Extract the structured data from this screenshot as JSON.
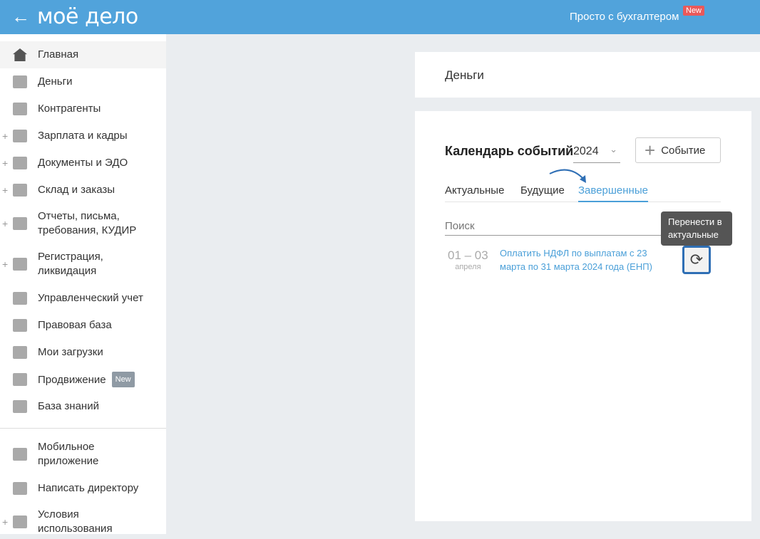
{
  "header": {
    "back": "←",
    "logo": "моё дело",
    "promo": "Просто с бухгалтером",
    "promo_badge": "New"
  },
  "sidebar": {
    "items": [
      {
        "label": "Главная",
        "icon": "home-icon"
      },
      {
        "label": "Деньги",
        "icon": "money-icon"
      },
      {
        "label": "Контрагенты",
        "icon": "contractor-icon"
      },
      {
        "label": "Зарплата и кадры",
        "icon": "wallet-icon",
        "expandable": "+"
      },
      {
        "label": "Документы и ЭДО",
        "icon": "folder-icon",
        "expandable": "+"
      },
      {
        "label": "Склад и заказы",
        "icon": "cart-icon",
        "expandable": "+"
      },
      {
        "label": "Отчеты, письма, требования, КУДИР",
        "icon": "report-icon",
        "expandable": "+"
      },
      {
        "label": "Регистрация, ликвидация",
        "icon": "registration-icon",
        "expandable": "+"
      },
      {
        "label": "Управленческий учет",
        "icon": "ruble-icon"
      },
      {
        "label": "Правовая база",
        "icon": "briefcase-icon"
      },
      {
        "label": "Мои загрузки",
        "icon": "folder-icon"
      },
      {
        "label": "Продвижение",
        "icon": "chart-icon",
        "badge": "New"
      },
      {
        "label": "База знаний",
        "icon": "graduation-icon"
      },
      {
        "label": "Мобильное приложение",
        "icon": "phone-icon"
      },
      {
        "label": "Написать директору",
        "icon": "chat-icon"
      },
      {
        "label": "Условия использования",
        "icon": "more-icon",
        "expandable": "+"
      }
    ]
  },
  "main": {
    "section_title": "Деньги",
    "calendar_title": "Календарь событий",
    "year": "2024",
    "add_event": "Событие",
    "tabs": [
      {
        "label": "Актуальные"
      },
      {
        "label": "Будущие"
      },
      {
        "label": "Завершенные"
      }
    ],
    "search_placeholder": "Поиск",
    "events": [
      {
        "date": "01 – 03",
        "month": "апреля",
        "title": "Оплатить НДФЛ по выплатам с 23 марта по 31 марта 2024 года (ЕНП)"
      }
    ],
    "tooltip": "Перенести в актуальные"
  }
}
